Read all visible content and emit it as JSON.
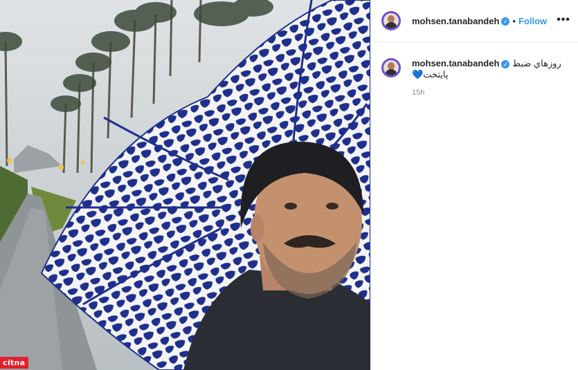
{
  "post": {
    "username": "mohsen.tanabandeh",
    "verified_mark": "✓",
    "separator": "•",
    "follow_label": "Follow",
    "more_label": "•••",
    "caption_line1": "روزهاي ضبط",
    "caption_line2": "پايتخت",
    "caption_emoji": "💙",
    "timestamp": "15h"
  },
  "photo": {
    "description_icon": "photo",
    "watermark": "citna"
  },
  "colors": {
    "accent": "#3897f0",
    "umbrella_blue": "#1f2f8c",
    "watermark_red": "#e0202a"
  }
}
